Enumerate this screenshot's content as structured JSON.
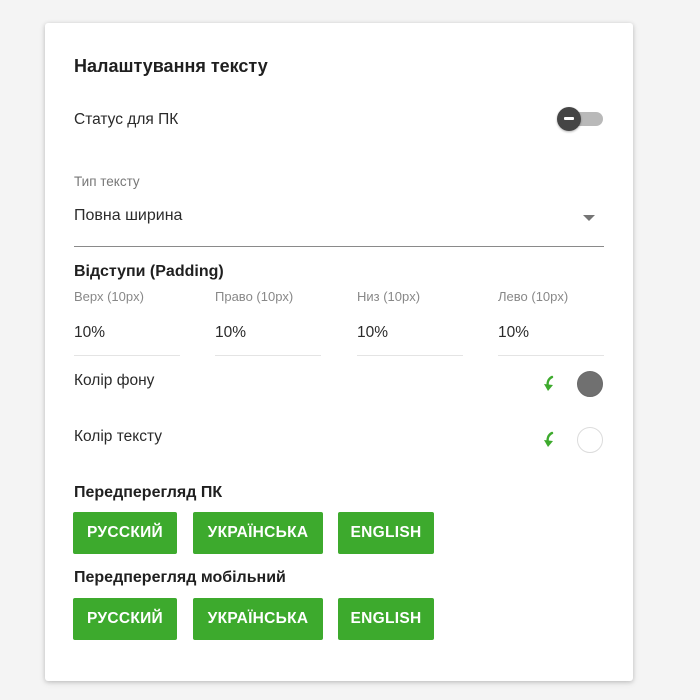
{
  "panel": {
    "title": "Налаштування тексту"
  },
  "status": {
    "label": "Статус для ПК",
    "toggle_on": false
  },
  "text_type": {
    "label": "Тип тексту",
    "value": "Повна ширина"
  },
  "padding": {
    "title": "Відступи (Padding)",
    "fields": [
      {
        "label": "Верх (10px)",
        "value": "10%"
      },
      {
        "label": "Право (10px)",
        "value": "10%"
      },
      {
        "label": "Низ (10px)",
        "value": "10%"
      },
      {
        "label": "Лево (10px)",
        "value": "10%"
      }
    ]
  },
  "colors": {
    "background": {
      "label": "Колір фону",
      "swatch": "#707070"
    },
    "text": {
      "label": "Колір тексту",
      "swatch": "#ffffff"
    },
    "accent": "#3daa2d"
  },
  "preview_pc": {
    "title": "Передперегляд ПК",
    "buttons": [
      "РУССКИЙ",
      "УКРАЇНСЬКА",
      "ENGLISH"
    ]
  },
  "preview_mobile": {
    "title": "Передперегляд мобільний",
    "buttons": [
      "РУССКИЙ",
      "УКРАЇНСЬКА",
      "ENGLISH"
    ]
  }
}
